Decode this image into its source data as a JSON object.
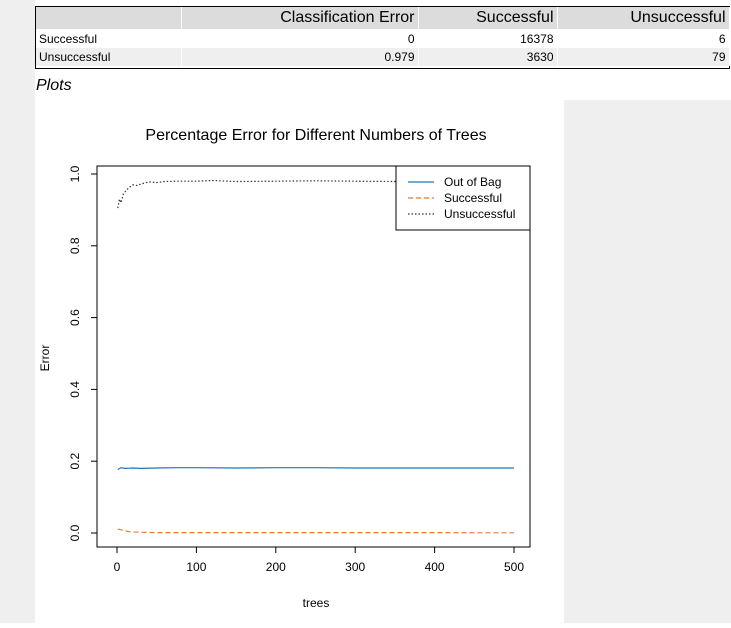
{
  "table": {
    "headers": [
      "",
      "Classification Error",
      "Successful",
      "Unsuccessful"
    ],
    "rows": [
      [
        "Successful",
        "0",
        "16378",
        "6"
      ],
      [
        "Unsuccessful",
        "0.979",
        "3630",
        "79"
      ]
    ]
  },
  "section_label": "Plots",
  "chart_data": {
    "type": "line",
    "title": "Percentage Error for Different Numbers of Trees",
    "xlabel": "trees",
    "ylabel": "Error",
    "xlim": [
      0,
      500
    ],
    "ylim": [
      0,
      1
    ],
    "x_ticks": [
      0,
      100,
      200,
      300,
      400,
      500
    ],
    "y_ticks": [
      0.0,
      0.2,
      0.4,
      0.6,
      0.8,
      1.0
    ],
    "y_tick_labels": [
      "0.0",
      "0.2",
      "0.4",
      "0.6",
      "0.8",
      "1.0"
    ],
    "legend_position": "top-right",
    "grid": false,
    "series": [
      {
        "name": "Out of Bag",
        "color": "#1f77b4",
        "dash": "solid",
        "x": [
          1,
          5,
          10,
          20,
          30,
          50,
          75,
          100,
          150,
          200,
          250,
          300,
          350,
          400,
          450,
          500
        ],
        "y": [
          0.177,
          0.182,
          0.18,
          0.181,
          0.18,
          0.181,
          0.182,
          0.182,
          0.181,
          0.182,
          0.182,
          0.181,
          0.181,
          0.181,
          0.181,
          0.181
        ]
      },
      {
        "name": "Successful",
        "color": "#e07b39",
        "dash": "dashed",
        "x": [
          1,
          5,
          10,
          15,
          20,
          30,
          50,
          75,
          100,
          150,
          200,
          250,
          300,
          350,
          400,
          450,
          500
        ],
        "y": [
          0.011,
          0.009,
          0.006,
          0.004,
          0.003,
          0.002,
          0.001,
          0.001,
          0.001,
          0.001,
          0.001,
          0.001,
          0.001,
          0.001,
          0.001,
          0.0005,
          0.0005
        ]
      },
      {
        "name": "Unsuccessful",
        "color": "#333333",
        "dash": "dotted",
        "x": [
          1,
          3,
          5,
          8,
          12,
          15,
          20,
          25,
          30,
          40,
          50,
          60,
          75,
          100,
          120,
          150,
          200,
          250,
          300,
          350,
          400,
          450,
          500
        ],
        "y": [
          0.905,
          0.93,
          0.92,
          0.945,
          0.955,
          0.962,
          0.97,
          0.968,
          0.972,
          0.978,
          0.976,
          0.979,
          0.98,
          0.98,
          0.982,
          0.979,
          0.98,
          0.981,
          0.98,
          0.979,
          0.979,
          0.979,
          0.979
        ]
      }
    ]
  }
}
